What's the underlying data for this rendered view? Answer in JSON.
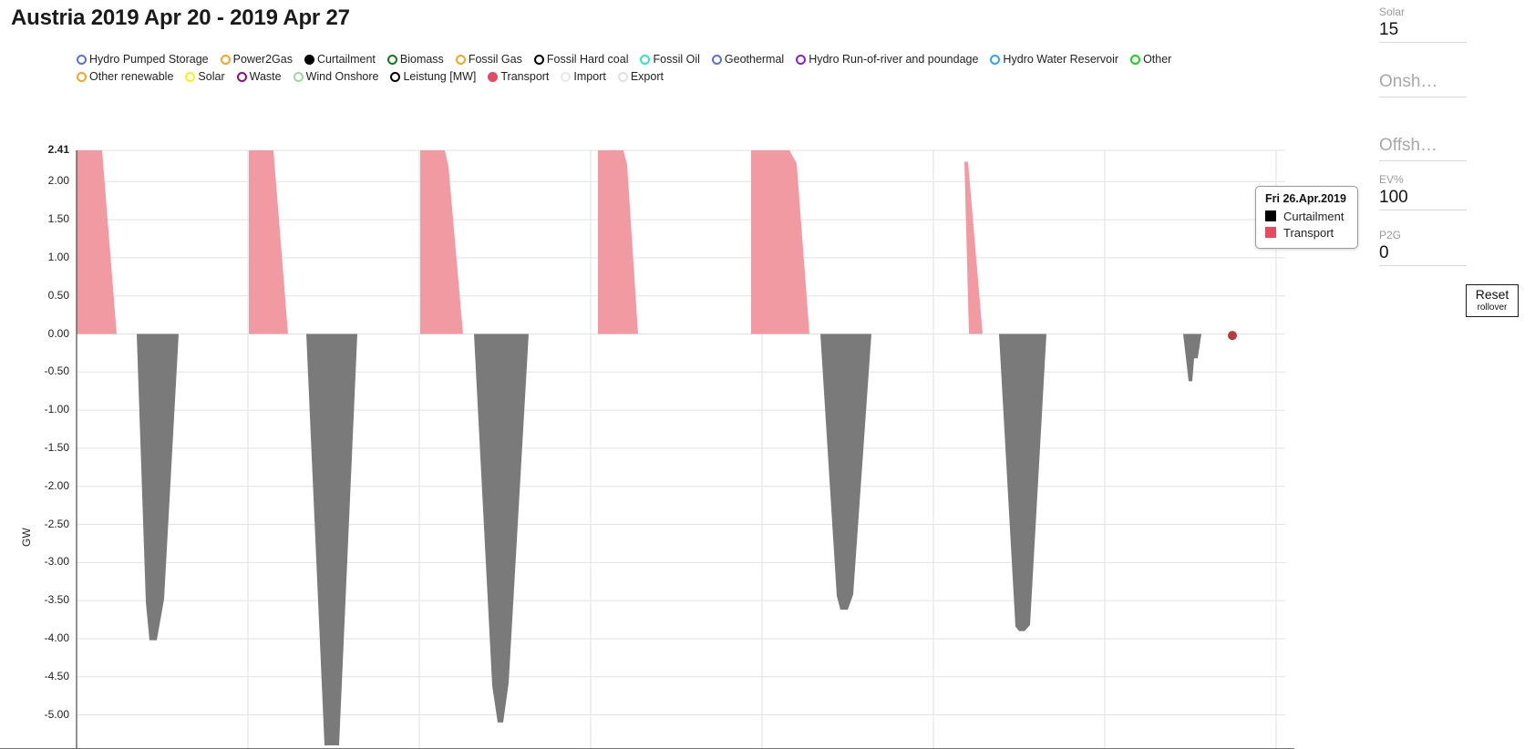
{
  "header": {
    "title": "Austria 2019 Apr 20 - 2019 Apr 27"
  },
  "legend": {
    "items": [
      {
        "label": "Hydro Pumped Storage",
        "color": "#5b6ee8",
        "filled": false
      },
      {
        "label": "Power2Gas",
        "color": "#f5a623",
        "filled": false
      },
      {
        "label": "Curtailment",
        "color": "#000000",
        "filled": true
      },
      {
        "label": "Biomass",
        "color": "#0f7a1e",
        "filled": false
      },
      {
        "label": "Fossil Gas",
        "color": "#f5a623",
        "filled": false
      },
      {
        "label": "Fossil Hard coal",
        "color": "#000000",
        "filled": false
      },
      {
        "label": "Fossil Oil",
        "color": "#2fe6c0",
        "filled": false
      },
      {
        "label": "Geothermal",
        "color": "#5b6ee8",
        "filled": false
      },
      {
        "label": "Hydro Run-of-river and poundage",
        "color": "#8a1fd6",
        "filled": false
      },
      {
        "label": "Hydro Water Reservoir",
        "color": "#2aa8ef",
        "filled": false
      },
      {
        "label": "Other",
        "color": "#16d41a",
        "filled": false
      },
      {
        "label": "Other renewable",
        "color": "#f5a623",
        "filled": false
      },
      {
        "label": "Solar",
        "color": "#f2f50c",
        "filled": false
      },
      {
        "label": "Waste",
        "color": "#8a0f8a",
        "filled": false
      },
      {
        "label": "Wind Onshore",
        "color": "#9fd6a8",
        "filled": false
      },
      {
        "label": "Leistung [MW]",
        "color": "#000000",
        "filled": false
      },
      {
        "label": "Transport",
        "color": "#e8495e",
        "filled": true
      },
      {
        "label": "Import",
        "color": "#e8e8e8",
        "filled": false
      },
      {
        "label": "Export",
        "color": "#e0e0e0",
        "filled": false
      }
    ]
  },
  "tooltip": {
    "title": "Fri 26.Apr.2019",
    "rows": [
      {
        "label": "Curtailment",
        "color": "#000000"
      },
      {
        "label": "Transport",
        "color": "#e8495e"
      }
    ]
  },
  "sidebar": {
    "fields": [
      {
        "name": "solar",
        "label": "Solar",
        "value": "15",
        "label_big": false
      },
      {
        "name": "onshore",
        "label": "Onsh…",
        "value": "",
        "label_big": true
      },
      {
        "name": "offshore",
        "label": "Offsh…",
        "value": "",
        "label_big": true
      },
      {
        "name": "ev",
        "label": "EV%",
        "value": "100",
        "label_big": false
      },
      {
        "name": "p2g",
        "label": "P2G",
        "value": "0",
        "label_big": false
      }
    ],
    "reset_button": {
      "label": "Reset",
      "sublabel": "rollover"
    }
  },
  "chart_data": {
    "type": "area",
    "title": "Austria 2019 Apr 20 - 2019 Apr 27",
    "xlabel": "",
    "ylabel": "GW",
    "ylim": [
      -5.4,
      2.41
    ],
    "grid": true,
    "legend_position": "top",
    "y_ticks": [
      2.41,
      2.0,
      1.5,
      1.0,
      0.5,
      0.0,
      -0.5,
      -1.0,
      -1.5,
      -2.0,
      -2.5,
      -3.0,
      -3.5,
      -4.0,
      -4.5,
      -5.0
    ],
    "x_gridlines": [
      84,
      272,
      460,
      648,
      836,
      1024,
      1212,
      1400
    ],
    "x_axis_note": "8 daily gridlines spanning 2019 Apr 20 through 2019 Apr 27",
    "series": [
      {
        "name": "Transport",
        "color": "#f29aa1",
        "polygons": [
          [
            [
              84,
              2.41
            ],
            [
              112,
              2.41
            ],
            [
              128,
              0.0
            ],
            [
              84,
              0.0
            ]
          ],
          [
            [
              273,
              2.41
            ],
            [
              300,
              2.41
            ],
            [
              316,
              0.0
            ],
            [
              273,
              0.0
            ]
          ],
          [
            [
              461,
              2.41
            ],
            [
              488,
              2.41
            ],
            [
              492,
              2.2
            ],
            [
              508,
              0.0
            ],
            [
              461,
              0.0
            ]
          ],
          [
            [
              656,
              2.41
            ],
            [
              684,
              2.41
            ],
            [
              688,
              2.22
            ],
            [
              700,
              0.0
            ],
            [
              656,
              0.0
            ]
          ],
          [
            [
              824,
              2.41
            ],
            [
              866,
              2.41
            ],
            [
              874,
              2.24
            ],
            [
              888,
              0.0
            ],
            [
              824,
              0.0
            ]
          ],
          [
            [
              1058,
              2.26
            ],
            [
              1062,
              2.26
            ],
            [
              1078,
              0.0
            ],
            [
              1063,
              0.0
            ]
          ]
        ]
      },
      {
        "name": "Curtailment",
        "color": "#7a7a7a",
        "polygons": [
          [
            [
              150,
              0.0
            ],
            [
              196,
              0.0
            ],
            [
              180,
              -3.48
            ],
            [
              172,
              -4.02
            ],
            [
              164,
              -4.02
            ],
            [
              160,
              -3.52
            ],
            [
              150,
              0.0
            ]
          ],
          [
            [
              336,
              0.0
            ],
            [
              392,
              0.0
            ],
            [
              372,
              -5.4
            ],
            [
              356,
              -5.4
            ],
            [
              336,
              0.0
            ]
          ],
          [
            [
              520,
              0.0
            ],
            [
              580,
              0.0
            ],
            [
              558,
              -4.58
            ],
            [
              552,
              -5.1
            ],
            [
              546,
              -5.1
            ],
            [
              540,
              -4.62
            ],
            [
              520,
              0.0
            ]
          ],
          [
            [
              900,
              0.0
            ],
            [
              956,
              0.0
            ],
            [
              936,
              -3.42
            ],
            [
              930,
              -3.62
            ],
            [
              922,
              -3.62
            ],
            [
              918,
              -3.44
            ],
            [
              900,
              0.0
            ]
          ],
          [
            [
              1096,
              0.0
            ],
            [
              1148,
              0.0
            ],
            [
              1130,
              -3.82
            ],
            [
              1124,
              -3.9
            ],
            [
              1118,
              -3.9
            ],
            [
              1114,
              -3.84
            ],
            [
              1096,
              0.0
            ]
          ],
          [
            [
              1298,
              0.0
            ],
            [
              1318,
              0.0
            ],
            [
              1314,
              -0.32
            ],
            [
              1310,
              -0.32
            ],
            [
              1308,
              -0.62
            ],
            [
              1304,
              -0.62
            ],
            [
              1298,
              0.0
            ]
          ]
        ]
      },
      {
        "name": "Transport marker",
        "color": "#b83a42",
        "points": [
          [
            1352,
            -0.02
          ]
        ]
      }
    ]
  }
}
